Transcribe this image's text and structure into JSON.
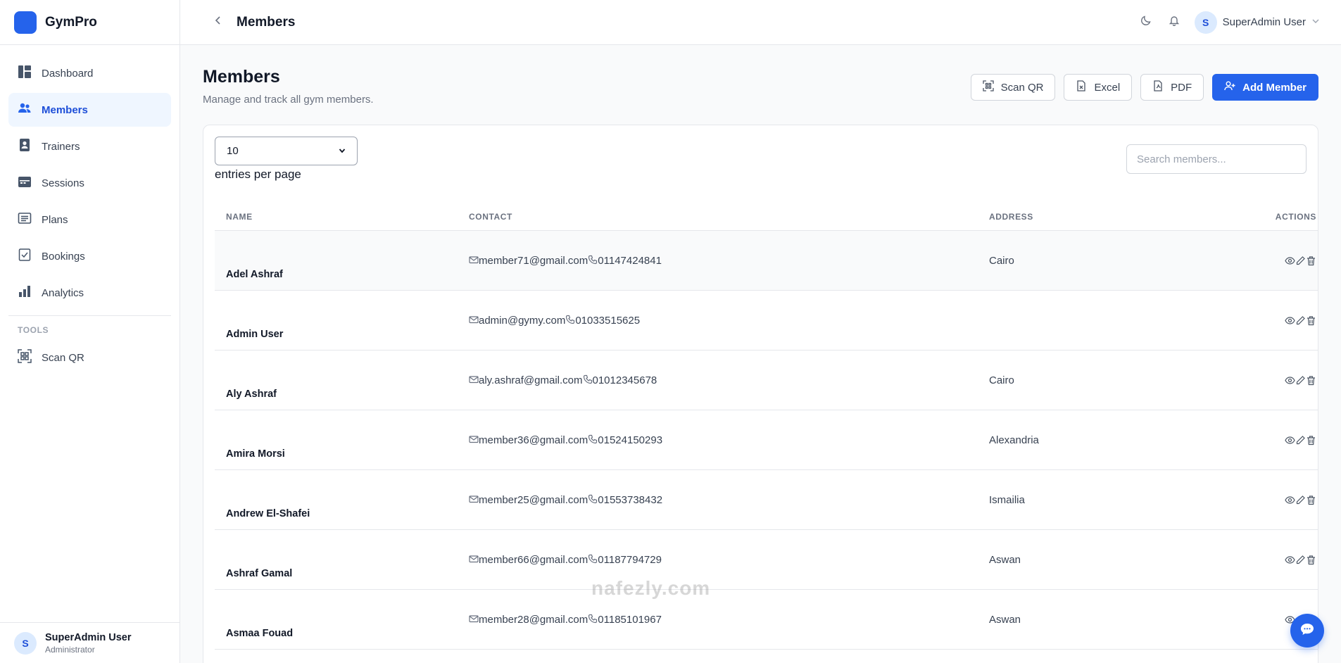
{
  "app": {
    "name": "GymPro"
  },
  "sidebar": {
    "items": [
      {
        "label": "Dashboard",
        "icon": "dashboard-icon",
        "active": false
      },
      {
        "label": "Members",
        "icon": "users-icon",
        "active": true
      },
      {
        "label": "Trainers",
        "icon": "trainer-badge-icon",
        "active": false
      },
      {
        "label": "Sessions",
        "icon": "calendar-icon",
        "active": false
      },
      {
        "label": "Plans",
        "icon": "list-icon",
        "active": false
      },
      {
        "label": "Bookings",
        "icon": "booking-icon",
        "active": false
      },
      {
        "label": "Analytics",
        "icon": "bar-chart-icon",
        "active": false
      }
    ],
    "tools_title": "TOOLS",
    "tools": [
      {
        "label": "Scan QR",
        "icon": "qr-scan-icon"
      }
    ],
    "footer": {
      "avatar": "S",
      "name": "SuperAdmin User",
      "role": "Administrator"
    }
  },
  "topbar": {
    "title": "Members",
    "user_avatar": "S",
    "user_name": "SuperAdmin User"
  },
  "page": {
    "title": "Members",
    "subtitle": "Manage and track all gym members.",
    "buttons": {
      "scan_qr": "Scan QR",
      "excel": "Excel",
      "pdf": "PDF",
      "add_member": "Add Member"
    }
  },
  "table_controls": {
    "per_page_value": "10",
    "per_page_label": "entries per page",
    "search_placeholder": "Search members..."
  },
  "table": {
    "headers": {
      "name": "NAME",
      "contact": "CONTACT",
      "address": "ADDRESS",
      "actions": "ACTIONS"
    },
    "rows": [
      {
        "name": "Adel Ashraf",
        "email": "member71@gmail.com",
        "phone": "01147424841",
        "address": "Cairo"
      },
      {
        "name": "Admin User",
        "email": "admin@gymy.com",
        "phone": "01033515625",
        "address": ""
      },
      {
        "name": "Aly Ashraf",
        "email": "aly.ashraf@gmail.com",
        "phone": "01012345678",
        "address": "Cairo"
      },
      {
        "name": "Amira Morsi",
        "email": "member36@gmail.com",
        "phone": "01524150293",
        "address": "Alexandria"
      },
      {
        "name": "Andrew El-Shafei",
        "email": "member25@gmail.com",
        "phone": "01553738432",
        "address": "Ismailia"
      },
      {
        "name": "Ashraf Gamal",
        "email": "member66@gmail.com",
        "phone": "01187794729",
        "address": "Aswan"
      },
      {
        "name": "Asmaa Fouad",
        "email": "member28@gmail.com",
        "phone": "01185101967",
        "address": "Aswan"
      }
    ]
  },
  "watermark": "nafezly.com",
  "colors": {
    "primary": "#2563eb",
    "active_bg": "#eff6ff"
  }
}
